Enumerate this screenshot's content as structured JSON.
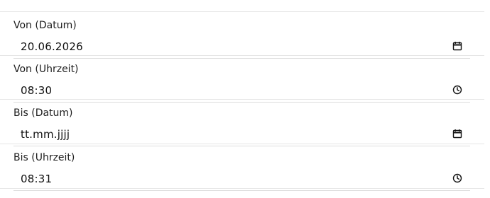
{
  "fields": [
    {
      "label": "Von (Datum)",
      "value": "20.06.2026",
      "icon": "calendar-icon"
    },
    {
      "label": "Von (Uhrzeit)",
      "value": "08:30",
      "icon": "clock-icon"
    },
    {
      "label": "Bis (Datum)",
      "value": "tt.mm.jjjj",
      "icon": "calendar-icon"
    },
    {
      "label": "Bis (Uhrzeit)",
      "value": "08:31",
      "icon": "clock-icon"
    }
  ]
}
